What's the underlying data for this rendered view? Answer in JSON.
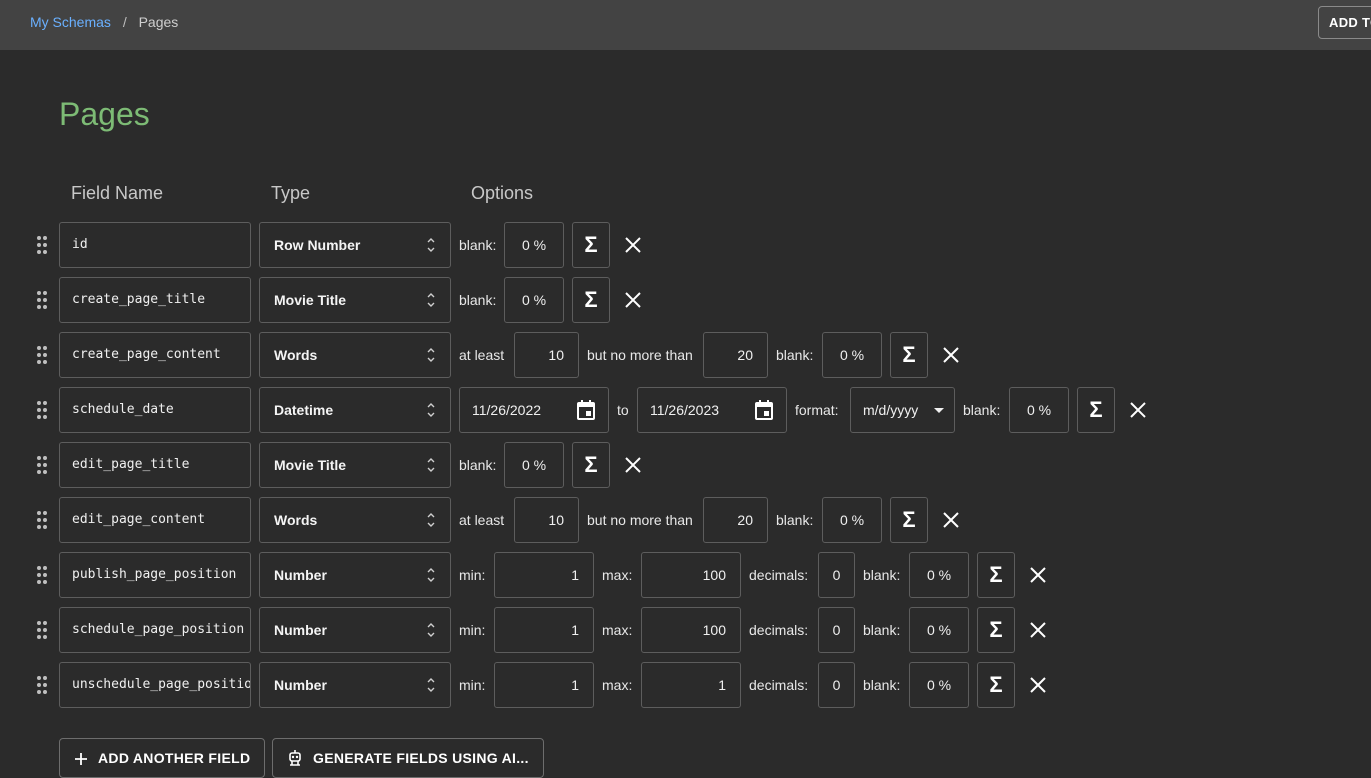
{
  "breadcrumb": {
    "root": "My Schemas",
    "separator": "/",
    "current": "Pages"
  },
  "header": {
    "add_button": "ADD TO"
  },
  "page_title": "Pages",
  "columns": {
    "name": "Field Name",
    "type": "Type",
    "options": "Options"
  },
  "labels": {
    "blank": "blank:",
    "at_least": "at least",
    "no_more": "but no more than",
    "to": "to",
    "format": "format:",
    "min": "min:",
    "max": "max:",
    "decimals": "decimals:",
    "sigma": "Σ"
  },
  "fields": [
    {
      "name": "id",
      "type": "Row Number",
      "blank": "0 %"
    },
    {
      "name": "create_page_title",
      "type": "Movie Title",
      "blank": "0 %"
    },
    {
      "name": "create_page_content",
      "type": "Words",
      "at_least": "10",
      "no_more": "20",
      "blank": "0 %"
    },
    {
      "name": "schedule_date",
      "type": "Datetime",
      "from": "11/26/2022",
      "to": "11/26/2023",
      "format": "m/d/yyyy",
      "blank": "0 %"
    },
    {
      "name": "edit_page_title",
      "type": "Movie Title",
      "blank": "0 %"
    },
    {
      "name": "edit_page_content",
      "type": "Words",
      "at_least": "10",
      "no_more": "20",
      "blank": "0 %"
    },
    {
      "name": "publish_page_position",
      "type": "Number",
      "min": "1",
      "max": "100",
      "decimals": "0",
      "blank": "0 %"
    },
    {
      "name": "schedule_page_position",
      "type": "Number",
      "min": "1",
      "max": "100",
      "decimals": "0",
      "blank": "0 %"
    },
    {
      "name": "unschedule_page_position",
      "type": "Number",
      "min": "1",
      "max": "1",
      "decimals": "0",
      "blank": "0 %"
    }
  ],
  "buttons": {
    "add_field": "ADD ANOTHER FIELD",
    "generate_ai": "GENERATE FIELDS USING AI..."
  },
  "colors": {
    "accent_title": "#7dbb75",
    "link": "#6ab0ff",
    "background": "#2b2b2b",
    "topbar": "#434343"
  }
}
